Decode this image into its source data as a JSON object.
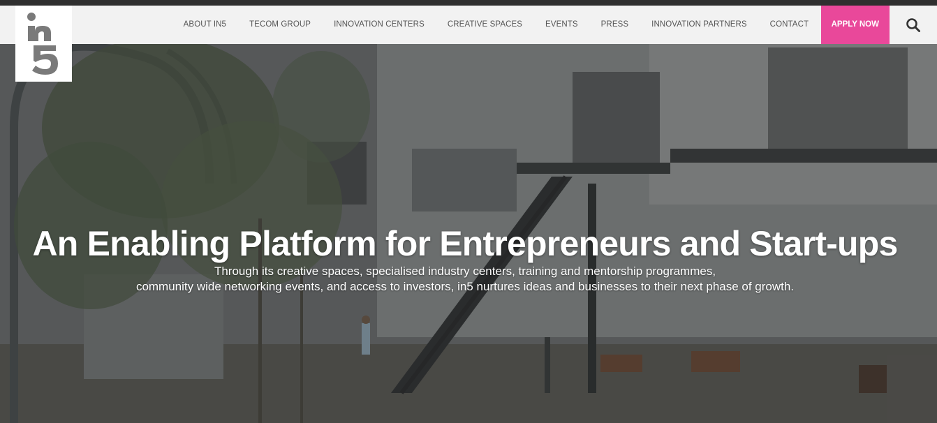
{
  "brand": {
    "logo_text": "in5"
  },
  "nav": {
    "items": [
      {
        "label": "ABOUT in5",
        "name": "nav-about"
      },
      {
        "label": "TECOM GROUP",
        "name": "nav-tecom-group"
      },
      {
        "label": "INNOVATION CENTERS",
        "name": "nav-innovation-centers"
      },
      {
        "label": "CREATIVE SPACES",
        "name": "nav-creative-spaces"
      },
      {
        "label": "EVENTS",
        "name": "nav-events"
      },
      {
        "label": "PRESS",
        "name": "nav-press"
      },
      {
        "label": "INNOVATION PARTNERS",
        "name": "nav-innovation-partners"
      },
      {
        "label": "CONTACT",
        "name": "nav-contact"
      }
    ],
    "apply_label": "APPLY NOW",
    "search_icon": "search-icon"
  },
  "hero": {
    "headline": "An Enabling Platform for Entrepreneurs and Start-ups",
    "subtext_line1": "Through its creative spaces, specialised industry centers, training and mentorship programmes,",
    "subtext_line2": "community wide networking events, and access to investors, in5 nurtures ideas and businesses to their next phase of growth."
  },
  "colors": {
    "accent": "#e9489a",
    "nav_bg": "#f2f2f2",
    "nav_text": "#555555",
    "logo_gray": "#7a7a7a"
  }
}
